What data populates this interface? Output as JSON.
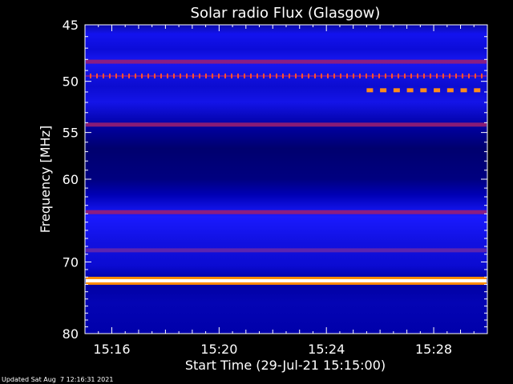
{
  "chart_data": {
    "type": "heatmap",
    "title": "Solar radio Flux (Glasgow)",
    "xlabel": "Start Time (29-Jul-21 15:15:00)",
    "ylabel": "Frequency [MHz]",
    "x_ticks": [
      "15:16",
      "15:20",
      "15:24",
      "15:28"
    ],
    "x_tick_minutes": [
      1,
      5,
      9,
      13
    ],
    "x_range_minutes": [
      0,
      15
    ],
    "y_ticks": [
      45,
      50,
      55,
      60,
      70,
      80
    ],
    "y_range": [
      45,
      80
    ],
    "y_scale": "log",
    "colormap": [
      "#000000",
      "#00005a",
      "#0000ff",
      "#ff0000",
      "#ffa500",
      "#ffffff"
    ],
    "features": [
      {
        "freq": 48.2,
        "intensity": 0.55
      },
      {
        "freq": 49.5,
        "intensity": 0.75,
        "pattern": "dotted"
      },
      {
        "freq": 54.2,
        "intensity": 0.45
      },
      {
        "freq": 63.8,
        "intensity": 0.5
      },
      {
        "freq": 68.5,
        "intensity": 0.4
      },
      {
        "freq": 72.5,
        "intensity": 1.0
      }
    ],
    "bursts": [
      {
        "start_min": 10.5,
        "end_min": 15.0,
        "freq": 50.8,
        "intensity": 0.8
      }
    ]
  },
  "footer": "Updated Sat Aug  7 12:16:31 2021"
}
